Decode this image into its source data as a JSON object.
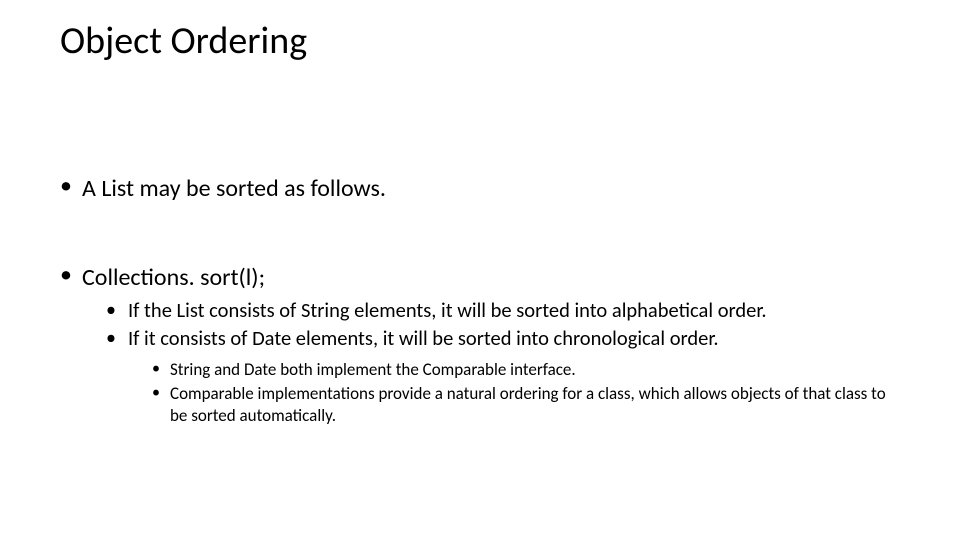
{
  "title": "Object Ordering",
  "bullets": {
    "b1": "A List may be sorted as follows.",
    "b2": "Collections. sort(l);",
    "b2_1": "If the List consists of String elements, it will be sorted into alphabetical order.",
    "b2_2": "If it consists of Date elements, it will be sorted into chronological order.",
    "b2_2_1": "String and Date both implement the Comparable interface.",
    "b2_2_2": "Comparable implementations provide a natural ordering for a class, which allows objects of that class to be sorted automatically."
  }
}
